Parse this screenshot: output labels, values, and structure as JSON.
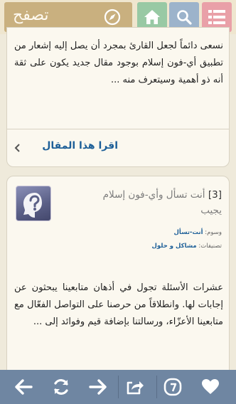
{
  "header": {
    "browse_label": "تصفح",
    "icons": [
      "menu-icon",
      "search-icon",
      "home-icon",
      "compass-icon"
    ]
  },
  "card1": {
    "excerpt": "نسعى دائماً لجعل القارئ بمجرد أن يصل إليه إشعار من تطبيق أي-فون إسلام بوجود مقال جديد يكون على ثقة أنه ذو أهمية وسيتعرف منه ...",
    "read_more": "اقرا هذا المقال"
  },
  "card2": {
    "number": "[3]",
    "title_line1": "أنت تسأل وأي-فون إسلام",
    "title_line2": "يجيب",
    "tags_label": "وسوم:",
    "tags_value": "أنت-تسأل",
    "categories_label": "تصنيفات:",
    "categories_value": "مشاكل و حلول",
    "excerpt": "عشرات الأسئلة تجول في أذهان متابعينا يبحثون عن إجابات لها. وانطلاقاً من حرصنا على التواصل الفعّال مع متابعينا الأعزّاء، ورسالتنا بإضافة قيم وفوائد إلى ..."
  },
  "toolbar": {
    "icons": [
      "back-arrow-icon",
      "refresh-icon",
      "forward-arrow-icon",
      "share-icon",
      "app-logo-icon",
      "favorite-heart-icon"
    ]
  },
  "colors": {
    "menu": "#e9a0a8",
    "search": "#9cb3cb",
    "home": "#98c9a4",
    "browse": "#c9b07f",
    "link": "#1d5f98",
    "toolbar": "#6f86a2"
  }
}
